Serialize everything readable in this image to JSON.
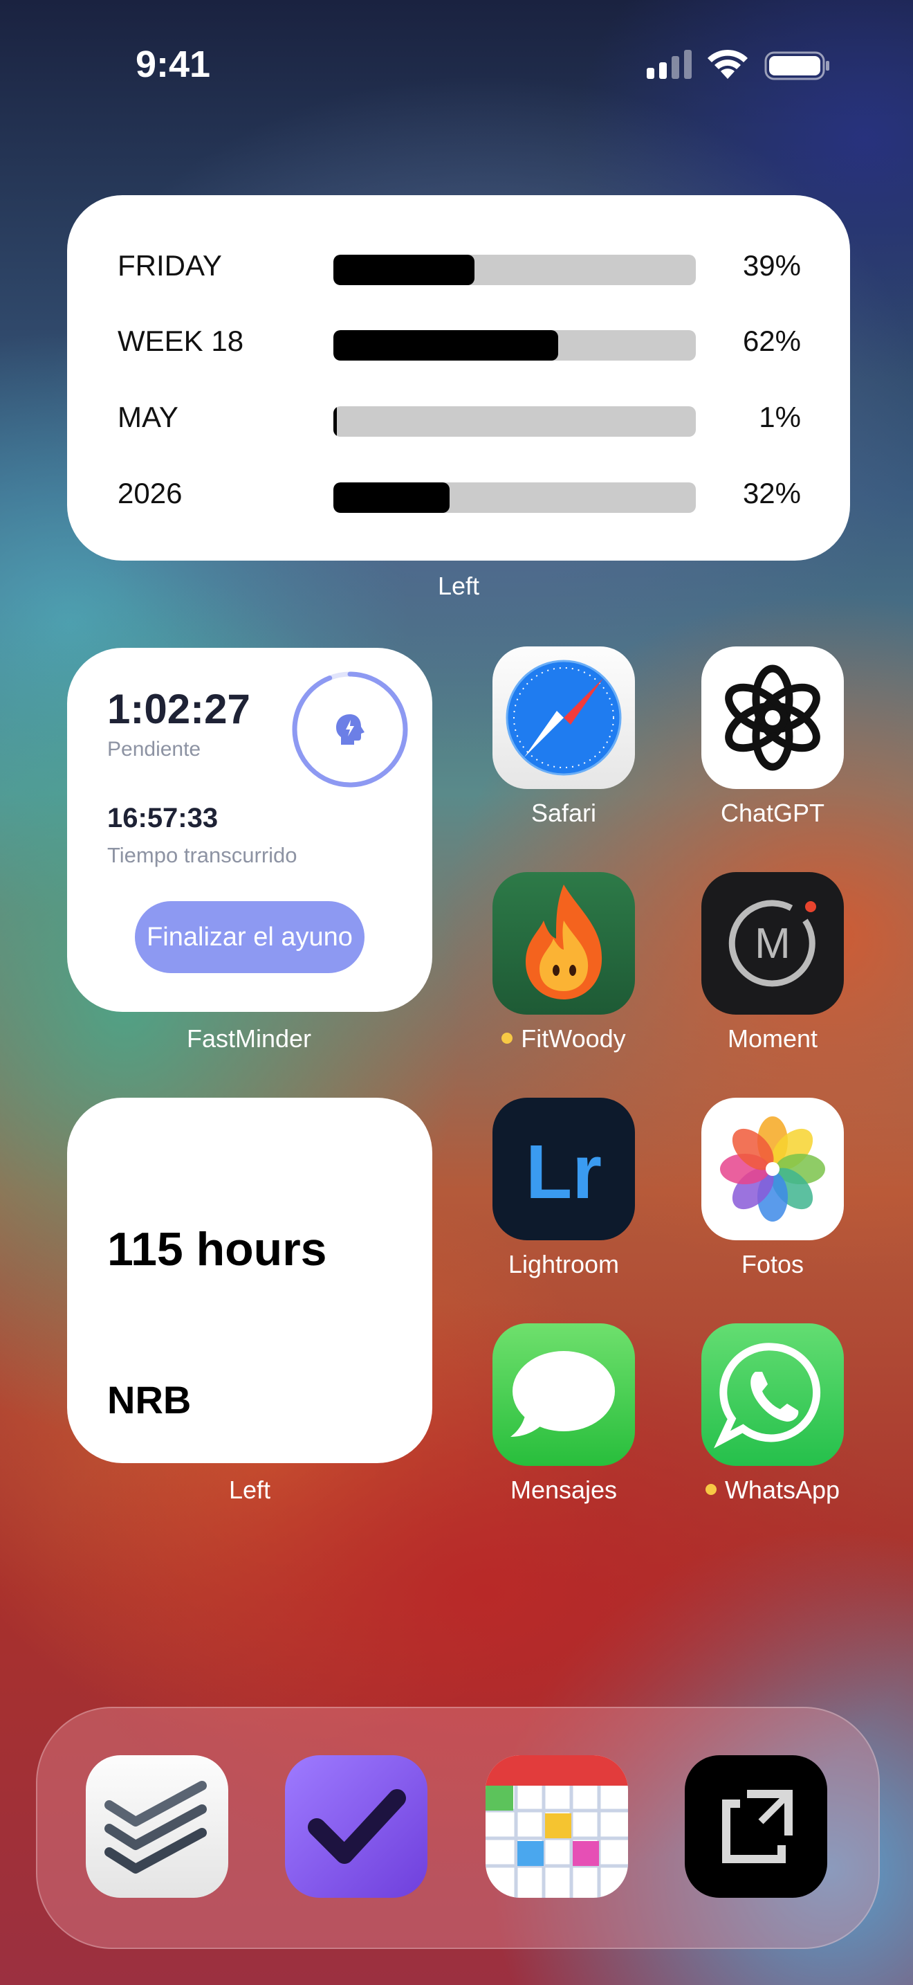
{
  "status_bar": {
    "time": "9:41"
  },
  "progress_widget": {
    "rows": [
      {
        "label": "FRIDAY",
        "percent": 39,
        "percent_text": "39%"
      },
      {
        "label": "WEEK 18",
        "percent": 62,
        "percent_text": "62%"
      },
      {
        "label": "MAY",
        "percent": 1,
        "percent_text": "1%"
      },
      {
        "label": "2026",
        "percent": 32,
        "percent_text": "32%"
      }
    ],
    "caption": "Left"
  },
  "fast_widget": {
    "remaining": "1:02:27",
    "remaining_label": "Pendiente",
    "elapsed": "16:57:33",
    "elapsed_label": "Tiempo transcurrido",
    "button": "Finalizar el ayuno",
    "progress": 0.94,
    "caption": "FastMinder"
  },
  "hours_widget": {
    "value": "115 hours",
    "label": "NRB",
    "caption": "Left"
  },
  "apps": {
    "safari": "Safari",
    "chatgpt": "ChatGPT",
    "fitwoody": "FitWoody",
    "moment": "Moment",
    "lightroom": "Lightroom",
    "fotos": "Fotos",
    "mensajes": "Mensajes",
    "whatsapp": "WhatsApp",
    "lightroom_logo": "Lr",
    "moment_logo": "M"
  },
  "colors": {
    "fast_accent": "#8d99f2",
    "dot_yellow": "#f7c945"
  }
}
